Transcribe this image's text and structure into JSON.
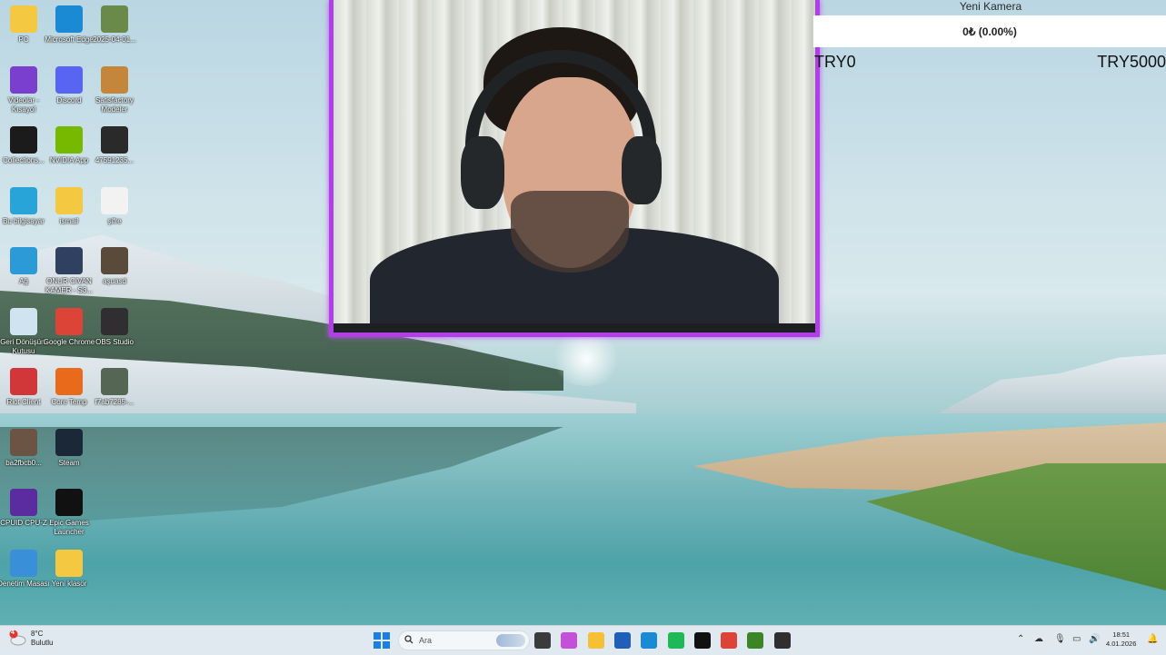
{
  "desktop": {
    "icons": [
      {
        "label": "PC",
        "icon": "folder-icon",
        "color": "#f5c842"
      },
      {
        "label": "Microsoft Edge",
        "icon": "edge-icon",
        "color": "#1a8ad4"
      },
      {
        "label": "2025-04-01...",
        "icon": "image-file-icon",
        "color": "#6a8a4a"
      },
      {
        "label": "Videolar - Kısayol",
        "icon": "videos-icon",
        "color": "#7b3fd0"
      },
      {
        "label": "Discord",
        "icon": "discord-icon",
        "color": "#5865f2"
      },
      {
        "label": "Satisfactory Modeler",
        "icon": "satisfactory-icon",
        "color": "#c4863a"
      },
      {
        "label": "Collections...",
        "icon": "collections-icon",
        "color": "#1b1b1b"
      },
      {
        "label": "NVIDIA App",
        "icon": "nvidia-icon",
        "color": "#76b900"
      },
      {
        "label": "47591235...",
        "icon": "image-file-icon",
        "color": "#2a2a2a"
      },
      {
        "label": "Bu bilgisayar",
        "icon": "this-pc-icon",
        "color": "#29a4d9"
      },
      {
        "label": "ismail",
        "icon": "folder-icon",
        "color": "#f5c842"
      },
      {
        "label": "şifre",
        "icon": "text-file-icon",
        "color": "#f2f2f2"
      },
      {
        "label": "Ağ",
        "icon": "network-icon",
        "color": "#2b9ad7"
      },
      {
        "label": "ONUR CIVAN KAMER - S3...",
        "icon": "image-file-icon",
        "color": "#304060"
      },
      {
        "label": "aşuasd",
        "icon": "image-file-icon",
        "color": "#5a4a3a"
      },
      {
        "label": "Geri Dönüşüm Kutusu",
        "icon": "recycle-bin-icon",
        "color": "#cfe4f0"
      },
      {
        "label": "Google Chrome",
        "icon": "chrome-icon",
        "color": "#db4437"
      },
      {
        "label": "OBS Studio",
        "icon": "obs-icon",
        "color": "#302e31"
      },
      {
        "label": "Riot Client",
        "icon": "riot-icon",
        "color": "#d13639"
      },
      {
        "label": "Core Temp",
        "icon": "core-temp-icon",
        "color": "#e86a1a"
      },
      {
        "label": "f7ab7285-...",
        "icon": "image-file-icon",
        "color": "#556655"
      },
      {
        "label": "ba2fbcb0...",
        "icon": "image-file-icon",
        "color": "#6b5444"
      },
      {
        "label": "Steam",
        "icon": "steam-icon",
        "color": "#1b2838"
      },
      {
        "label": "",
        "icon": "empty",
        "color": "transparent"
      },
      {
        "label": "CPUID CPU-Z",
        "icon": "cpuz-icon",
        "color": "#5a2ca0"
      },
      {
        "label": "Epic Games Launcher",
        "icon": "epic-games-icon",
        "color": "#111111"
      },
      {
        "label": "",
        "icon": "empty",
        "color": "transparent"
      },
      {
        "label": "Denetim Masası",
        "icon": "control-panel-icon",
        "color": "#3a8fd9"
      },
      {
        "label": "Yeni klasör",
        "icon": "folder-icon",
        "color": "#f5c842"
      }
    ]
  },
  "widget": {
    "title": "Yeni Kamera",
    "amount": "0₺ (0.00%)",
    "min_label": "TRY0",
    "max_label": "TRY5000"
  },
  "taskbar": {
    "weather_temp": "8°C",
    "weather_desc": "Bulutlu",
    "weather_badge": "4",
    "search_placeholder": "Ara",
    "time": "18:51",
    "date": "4.01.2026",
    "apps": [
      {
        "name": "task-view-icon",
        "color": "#3b3b3b"
      },
      {
        "name": "copilot-icon",
        "color": "#c44fd8"
      },
      {
        "name": "file-explorer-icon",
        "color": "#f5c035"
      },
      {
        "name": "microsoft-store-icon",
        "color": "#1f5fb8"
      },
      {
        "name": "edge-icon",
        "color": "#1a8ad4"
      },
      {
        "name": "spotify-icon",
        "color": "#1db954"
      },
      {
        "name": "apple-tv-icon",
        "color": "#111111"
      },
      {
        "name": "chrome-icon",
        "color": "#db4437"
      },
      {
        "name": "minecraft-icon",
        "color": "#3c8527"
      },
      {
        "name": "obs-icon",
        "color": "#302e31"
      }
    ]
  }
}
